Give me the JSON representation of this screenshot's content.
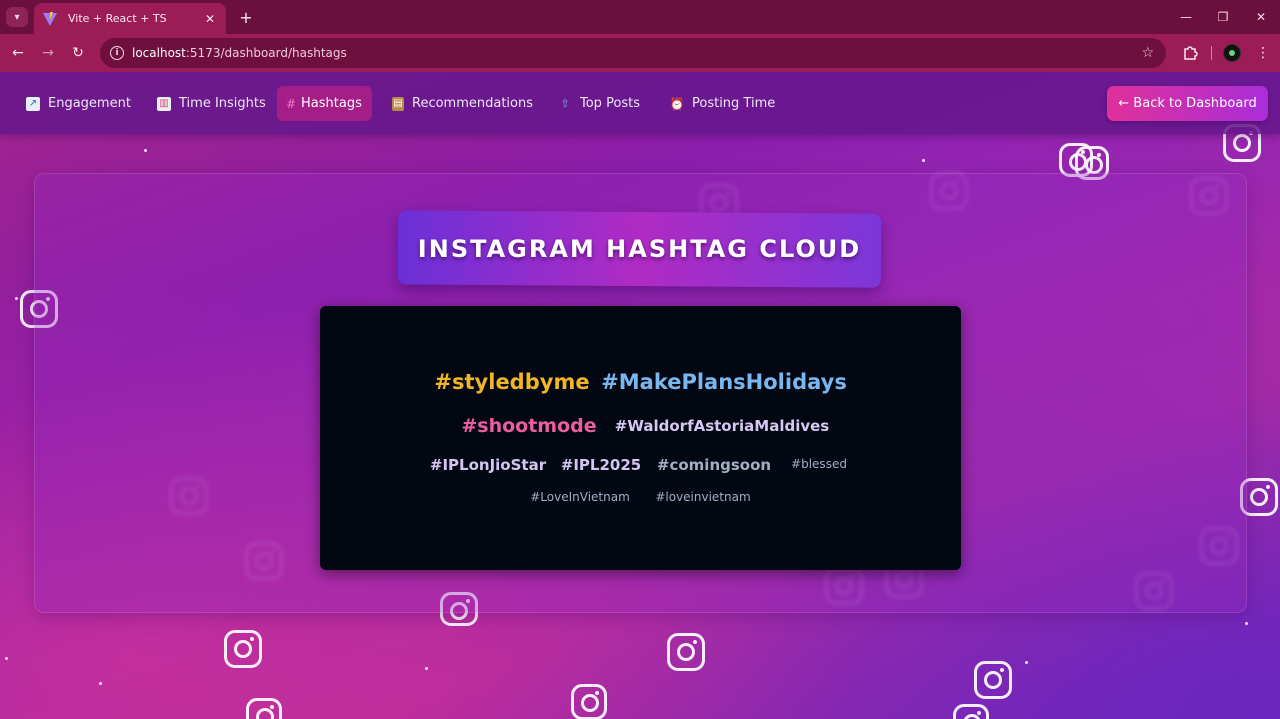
{
  "browser": {
    "tab_title": "Vite + React + TS",
    "url_host": "localhost",
    "url_rest": ":5173/dashboard/hashtags",
    "tab_close": "✕",
    "new_tab": "+",
    "back": "←",
    "forward": "→",
    "reload": "↻",
    "star": "☆",
    "minimize": "—",
    "restore": "❐",
    "close": "✕"
  },
  "nav": {
    "items": [
      {
        "label": "Engagement",
        "icon": "chart-increasing-icon",
        "active": false
      },
      {
        "label": "Time Insights",
        "icon": "bar-chart-icon",
        "active": false
      },
      {
        "label": "Hashtags",
        "icon": "hash-icon",
        "active": true
      },
      {
        "label": "Recommendations",
        "icon": "clipboard-icon",
        "active": false
      },
      {
        "label": "Top Posts",
        "icon": "top-arrow-icon",
        "active": false
      },
      {
        "label": "Posting Time",
        "icon": "alarm-clock-icon",
        "active": false
      }
    ],
    "back_button": "← Back to  Dashboard"
  },
  "page": {
    "title": "INSTAGRAM HASHTAG CLOUD"
  },
  "hashtags": [
    {
      "text": "#styledbyme",
      "color": "#f2b526"
    },
    {
      "text": "#MakePlansHolidays",
      "color": "#7ab7f0"
    },
    {
      "text": "#shootmode",
      "color": "#ec5ea1"
    },
    {
      "text": "#WaldorfAstoriaMaldives",
      "color": "#d7c7f2"
    },
    {
      "text": "#IPLonJioStar",
      "color": "#d3c6f0"
    },
    {
      "text": "#IPL2025",
      "color": "#d3c6f0"
    },
    {
      "text": "#comingsoon",
      "color": "#a4aec2"
    },
    {
      "text": "#blessed",
      "color": "#a4aec2"
    },
    {
      "text": "#LoveInVietnam",
      "color": "#a4aec2"
    },
    {
      "text": "#loveinvietnam",
      "color": "#a4aec2"
    }
  ],
  "colors": {
    "accent_pink": "#e0309a",
    "accent_purple": "#a92ed8",
    "cloud_bg": "#020712"
  }
}
